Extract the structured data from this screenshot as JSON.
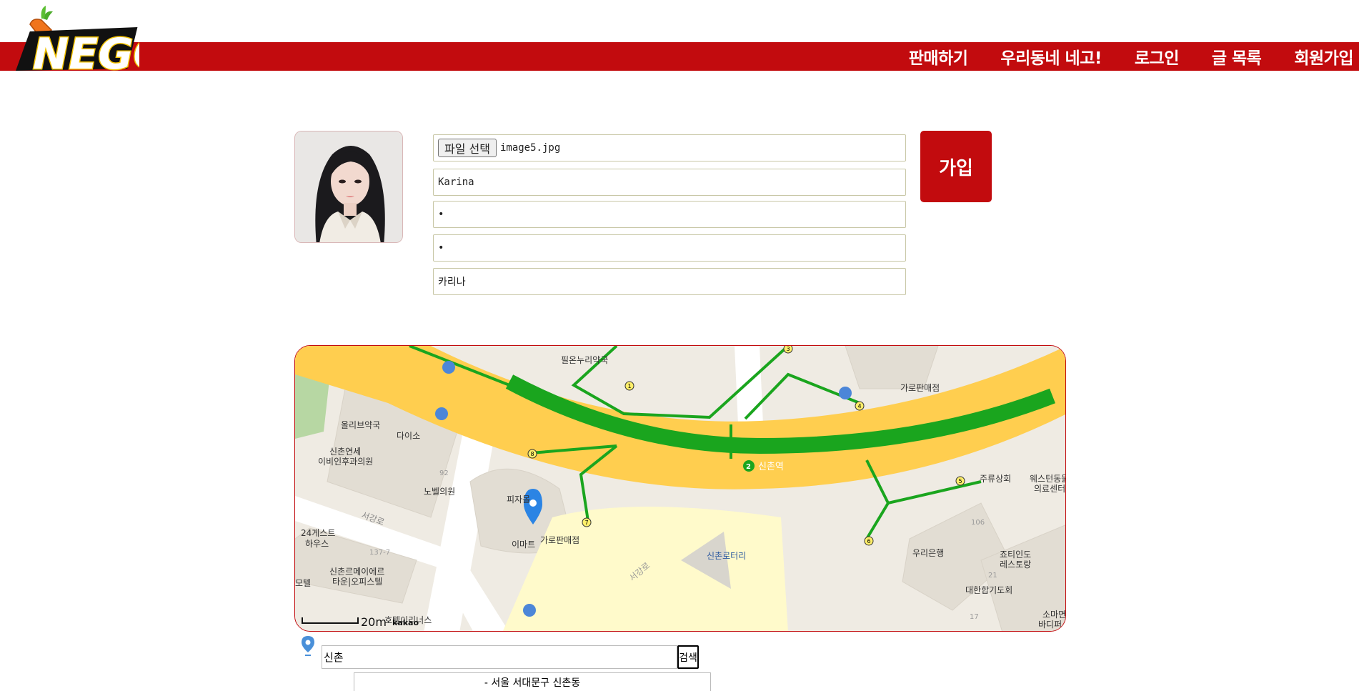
{
  "header": {
    "logo_text": "NEGO",
    "nav": [
      "판매하기",
      "우리동네 네고!",
      "로그인",
      "글 목록",
      "회원가입"
    ]
  },
  "form": {
    "file_button": "파일 선택",
    "file_name": "image5.jpg",
    "username": "Karina",
    "password": "•",
    "password_confirm": "•",
    "nickname": "카리나",
    "submit": "가입"
  },
  "map": {
    "labels": {
      "pharmacy_top": "필온누리약국",
      "street_vendor_top": "가로판매점",
      "olive": "올리브약국",
      "daiso": "다이소",
      "clinic": "신촌연세\n이비인후과의원",
      "clinic_l1": "신촌연세",
      "clinic_l2": "이비인후과의원",
      "nobel": "노벨의원",
      "pizza": "피자몰",
      "emart": "이마트",
      "street_vendor": "가로판매점",
      "station": "신촌역",
      "guesthouse_l1": "24게스트",
      "guesthouse_l2": "하우스",
      "officetel_l1": "신촌르메이에르",
      "officetel_l2": "타운|오피스텔",
      "motel": "모텔",
      "rotary": "신촌로터리",
      "liquor": "주류상회",
      "vet_l1": "웨스턴동물",
      "vet_l2": "의료센터",
      "woori": "우리은행",
      "resto_l1": "죠티인도",
      "resto_l2": "레스토랑",
      "korea_club": "대한합기도회",
      "soma_l1": "소마면",
      "soma_l2": "바디퍼",
      "road1": "서강로",
      "road2": "서강로",
      "hotel": "호텔이리너스",
      "n92": "92",
      "n106": "106",
      "n137": "137-7",
      "n21": "21",
      "n17": "17"
    },
    "scale": "20m",
    "brand": "kakao",
    "exits": [
      "1",
      "3",
      "4",
      "5",
      "6",
      "7",
      "8"
    ]
  },
  "search": {
    "query": "신촌",
    "button": "검색",
    "result": "- 서울 서대문구 신촌동"
  },
  "colors": {
    "brand_red": "#c20b0e",
    "road_yellow": "#ffce4f",
    "subway_green": "#1aa51e"
  }
}
